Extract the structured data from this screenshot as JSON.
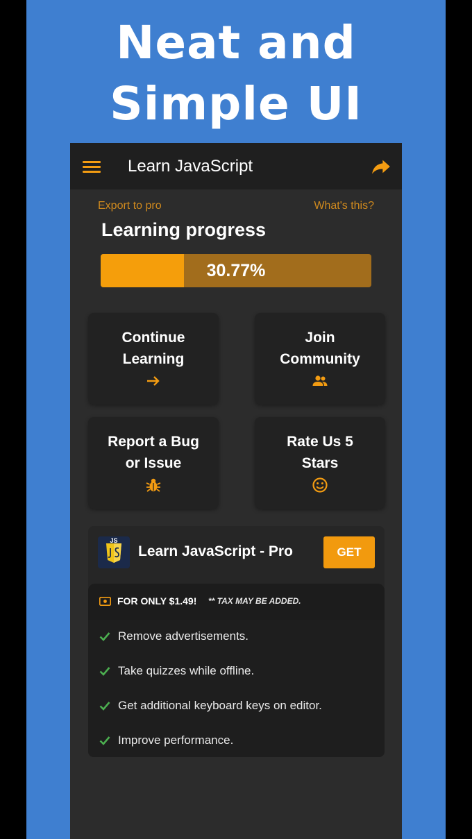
{
  "promo": {
    "headline_line1": "Neat and",
    "headline_line2": "Simple UI"
  },
  "appbar": {
    "title": "Learn JavaScript",
    "menu_icon": "hamburger-menu-icon",
    "share_icon": "share-icon"
  },
  "top_links": {
    "export": "Export to pro",
    "whats_this": "What's this?"
  },
  "progress": {
    "title": "Learning progress",
    "value_text": "30.77%",
    "value_percent": 30.77
  },
  "cards": [
    {
      "line1": "Continue",
      "line2": "Learning",
      "icon": "arrow-right-icon"
    },
    {
      "line1": "Join",
      "line2": "Community",
      "icon": "group-icon"
    },
    {
      "line1": "Report a Bug",
      "line2": "or Issue",
      "icon": "bug-icon"
    },
    {
      "line1": "Rate Us 5",
      "line2": "Stars",
      "icon": "smiley-icon"
    }
  ],
  "pro": {
    "logo_text": "JS",
    "title": "Learn JavaScript - Pro",
    "get_label": "GET",
    "price": "FOR ONLY $1.49!",
    "tax_note": "** TAX MAY BE ADDED.",
    "features": [
      "Remove advertisements.",
      "Take quizzes while offline.",
      "Get additional keyboard keys on editor.",
      "Improve performance."
    ]
  },
  "colors": {
    "accent": "#f39c12",
    "background_blue": "#3f7fd0",
    "app_bg": "#2c2c2c",
    "check_green": "#4caf50"
  }
}
